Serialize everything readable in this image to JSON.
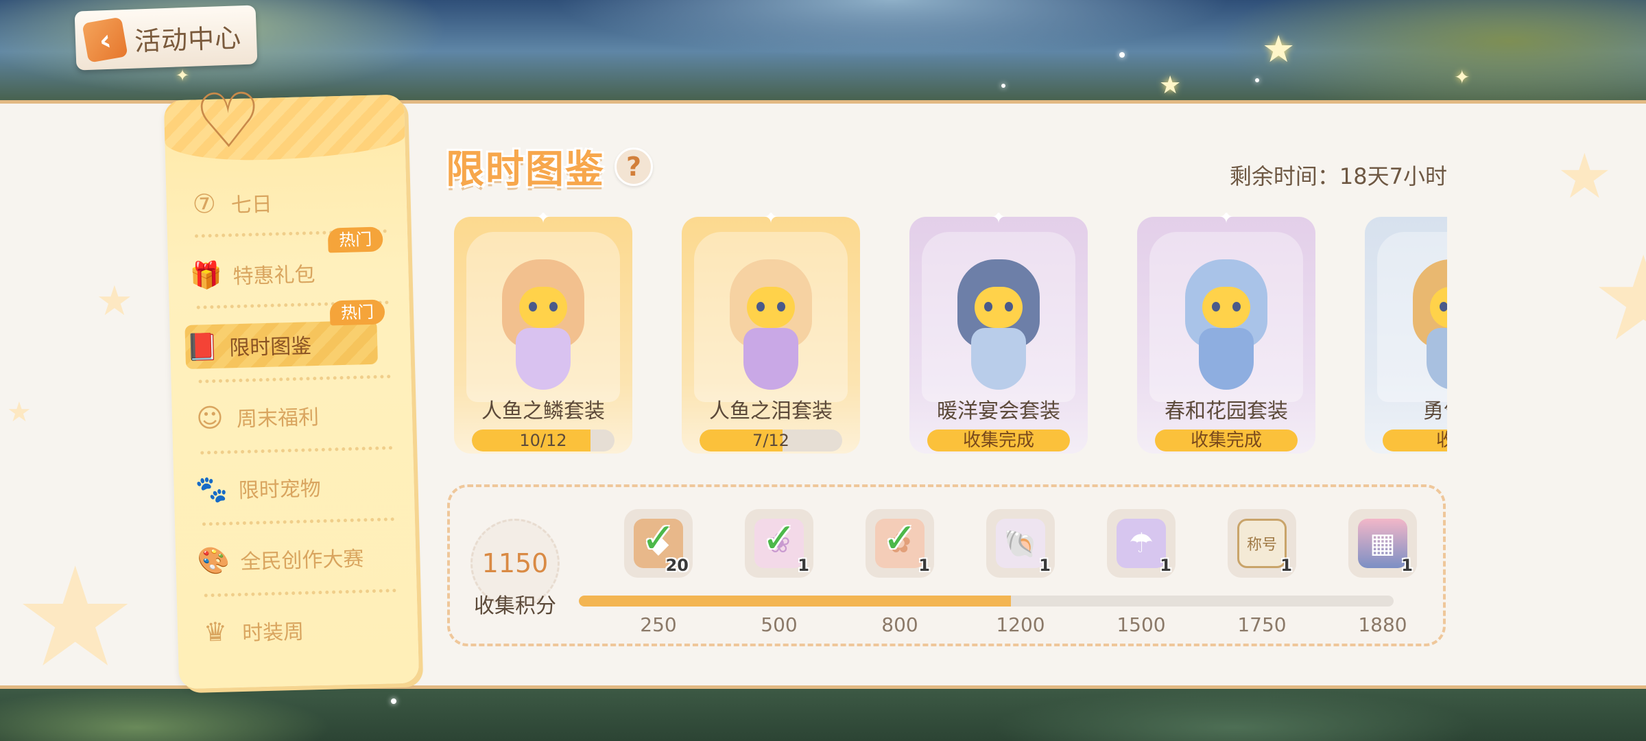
{
  "header": {
    "back_label": "活动中心"
  },
  "sidebar": {
    "items": [
      {
        "label": "七日",
        "icon": "clock-7-icon",
        "glyph": "⑦"
      },
      {
        "label": "特惠礼包",
        "icon": "gift-icon",
        "glyph": "🎁",
        "badge": "热门"
      },
      {
        "label": "限时图鉴",
        "icon": "book-icon",
        "glyph": "📕",
        "badge": "热门",
        "active": true
      },
      {
        "label": "周末福利",
        "icon": "weekend-icon",
        "glyph": "☺"
      },
      {
        "label": "限时宠物",
        "icon": "paw-icon",
        "glyph": "🐾"
      },
      {
        "label": "全民创作大赛",
        "icon": "palette-icon",
        "glyph": "🎨"
      },
      {
        "label": "时装周",
        "icon": "crown-icon",
        "glyph": "♛"
      }
    ]
  },
  "main": {
    "title": "限时图鉴",
    "help": "?",
    "remaining_label": "剩余时间：",
    "remaining_value": "18天7小时"
  },
  "cards": [
    {
      "name": "人鱼之鳞套装",
      "theme": "gold",
      "progress_text": "10/12",
      "progress": 0.8333,
      "hair": "#f2c08e",
      "body": "#d9c2f0"
    },
    {
      "name": "人鱼之泪套装",
      "theme": "gold",
      "progress_text": "7/12",
      "progress": 0.5833,
      "hair": "#f6d2a2",
      "body": "#c9a8e6"
    },
    {
      "name": "暖洋宴会套装",
      "theme": "purple",
      "status": "收集完成",
      "hair": "#6d7fa8",
      "body": "#b9cdea"
    },
    {
      "name": "春和花园套装",
      "theme": "purple",
      "status": "收集完成",
      "hair": "#a9c3e8",
      "body": "#8eaee0"
    },
    {
      "name": "勇气水",
      "theme": "blue",
      "status": "收集",
      "hair": "#e9b870",
      "body": "#a8c0e0"
    }
  ],
  "rewards": {
    "score": "1150",
    "score_label": "收集积分",
    "progress": 0.53,
    "items": [
      {
        "milestone": "250",
        "qty": "20",
        "claimed": true,
        "icon": "crystal-icon",
        "glyph": "◆",
        "color": "#e8b88a"
      },
      {
        "milestone": "500",
        "qty": "1",
        "claimed": true,
        "icon": "wreath-icon",
        "glyph": "❀",
        "color": "#f3d9e8"
      },
      {
        "milestone": "800",
        "qty": "1",
        "claimed": true,
        "icon": "shell-icon",
        "glyph": "✿",
        "color": "#f4cdb8"
      },
      {
        "milestone": "1200",
        "qty": "1",
        "claimed": false,
        "icon": "seashell-icon",
        "glyph": "🐚",
        "color": "#eee4f0"
      },
      {
        "milestone": "1500",
        "qty": "1",
        "claimed": false,
        "icon": "jellyfish-icon",
        "glyph": "☂",
        "color": "#d7c6ef"
      },
      {
        "milestone": "1750",
        "qty": "1",
        "claimed": false,
        "icon": "title-ticket-icon",
        "glyph": "称号",
        "color": "#f4ead6"
      },
      {
        "milestone": "1880",
        "qty": "1",
        "claimed": false,
        "icon": "scenery-icon",
        "glyph": "▦",
        "color": "#8a9cc8"
      }
    ]
  }
}
